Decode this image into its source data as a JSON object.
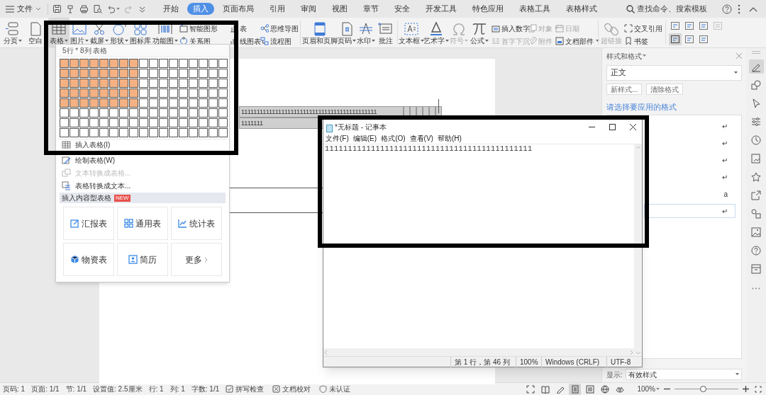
{
  "title_bar": {
    "file_menu": "文件",
    "tabs": [
      {
        "label": "开始",
        "selected": false
      },
      {
        "label": "插入",
        "selected": true
      },
      {
        "label": "页面布局",
        "selected": false
      },
      {
        "label": "引用",
        "selected": false
      },
      {
        "label": "审阅",
        "selected": false
      },
      {
        "label": "视图",
        "selected": false
      },
      {
        "label": "章节",
        "selected": false
      },
      {
        "label": "安全",
        "selected": false
      },
      {
        "label": "开发工具",
        "selected": false
      },
      {
        "label": "特色应用",
        "selected": false
      },
      {
        "label": "表格工具",
        "selected": false
      },
      {
        "label": "表格样式",
        "selected": false
      }
    ],
    "search_placeholder": "查找命令、搜索模板"
  },
  "ribbon": {
    "groups": [
      {
        "items": [
          {
            "kind": "large",
            "label": "分页",
            "dropdown": true,
            "selected": false,
            "disabled": false
          },
          {
            "kind": "large",
            "label": "空白",
            "dropdown": false,
            "selected": false,
            "disabled": false
          },
          {
            "kind": "large",
            "label": "表格",
            "dropdown": true,
            "selected": true,
            "disabled": false
          },
          {
            "kind": "large",
            "label": "图片",
            "dropdown": true,
            "selected": false,
            "disabled": false
          },
          {
            "kind": "large",
            "label": "截屏",
            "dropdown": true,
            "selected": false,
            "disabled": false
          },
          {
            "kind": "large",
            "label": "形状",
            "dropdown": true,
            "selected": false,
            "disabled": false
          },
          {
            "kind": "large",
            "label": "图标库",
            "dropdown": false,
            "selected": false,
            "disabled": false
          },
          {
            "kind": "large",
            "label": "功能图",
            "dropdown": true,
            "selected": false,
            "disabled": false
          },
          {
            "kind": "stack",
            "rows": [
              {
                "label": "智能图形",
                "dropdown": false,
                "disabled": false
              },
              {
                "label": "关系图",
                "dropdown": false,
                "disabled": false
              }
            ]
          },
          {
            "kind": "stack",
            "rows": [
              {
                "label": "表",
                "dropdown": false,
                "disabled": false
              },
              {
                "label": "线图表",
                "dropdown": false,
                "disabled": false
              }
            ]
          },
          {
            "kind": "stack",
            "rows": [
              {
                "label": "思维导图",
                "dropdown": false,
                "disabled": false
              },
              {
                "label": "流程图",
                "dropdown": false,
                "disabled": false
              }
            ]
          }
        ]
      },
      {
        "items": [
          {
            "kind": "large",
            "label": "页眉和页脚",
            "dropdown": false,
            "selected": false,
            "disabled": false
          },
          {
            "kind": "large",
            "label": "页码",
            "dropdown": true,
            "selected": false,
            "disabled": false
          },
          {
            "kind": "large",
            "label": "水印",
            "dropdown": true,
            "selected": false,
            "disabled": false
          },
          {
            "kind": "large",
            "label": "批注",
            "dropdown": false,
            "selected": false,
            "disabled": false
          }
        ]
      },
      {
        "items": [
          {
            "kind": "large",
            "label": "文本框",
            "dropdown": true,
            "selected": false,
            "disabled": false
          },
          {
            "kind": "large",
            "label": "艺术字",
            "dropdown": true,
            "selected": false,
            "disabled": false
          },
          {
            "kind": "large",
            "label": "符号",
            "dropdown": true,
            "selected": false,
            "disabled": true
          },
          {
            "kind": "large",
            "label": "公式",
            "dropdown": true,
            "selected": false,
            "disabled": false
          },
          {
            "kind": "stack",
            "rows": [
              {
                "label": "插入数字",
                "dropdown": false,
                "disabled": false
              },
              {
                "label": "首字下沉",
                "dropdown": false,
                "disabled": true
              }
            ]
          },
          {
            "kind": "stack",
            "rows": [
              {
                "label": "对象",
                "dropdown": true,
                "disabled": true
              },
              {
                "label": "附件",
                "dropdown": false,
                "disabled": true
              }
            ]
          },
          {
            "kind": "stack",
            "rows": [
              {
                "label": "日期",
                "dropdown": false,
                "disabled": true
              },
              {
                "label": "文档部件",
                "dropdown": true,
                "disabled": false
              }
            ]
          }
        ]
      },
      {
        "items": [
          {
            "kind": "large",
            "label": "超链接",
            "dropdown": false,
            "selected": false,
            "disabled": true
          },
          {
            "kind": "stack",
            "rows": [
              {
                "label": "交叉引用",
                "dropdown": false,
                "disabled": false
              },
              {
                "label": "书签",
                "dropdown": false,
                "disabled": false
              }
            ]
          }
        ]
      },
      {
        "items": [
          {
            "kind": "icon_grid",
            "buttons": [
              {
                "selected": false,
                "disabled": false
              },
              {
                "selected": false,
                "disabled": false
              },
              {
                "selected": false,
                "disabled": false
              },
              {
                "selected": false,
                "disabled": true
              },
              {
                "selected": true,
                "disabled": false
              },
              {
                "selected": false,
                "disabled": false
              },
              {
                "selected": false,
                "disabled": false
              }
            ]
          }
        ]
      }
    ]
  },
  "document": {
    "table_rows": [
      "11111111111111111111111111111111111111111111",
      "1111111"
    ]
  },
  "table_menu": {
    "size_label": "5行 * 8列 表格",
    "grid": [
      [
        true,
        true,
        true,
        true,
        true,
        true,
        true,
        true,
        false,
        false,
        false,
        false,
        false,
        false,
        false,
        false,
        false
      ],
      [
        true,
        true,
        true,
        true,
        true,
        true,
        true,
        true,
        false,
        false,
        false,
        false,
        false,
        false,
        false,
        false,
        false
      ],
      [
        true,
        true,
        true,
        true,
        true,
        true,
        true,
        true,
        false,
        false,
        false,
        false,
        false,
        false,
        false,
        false,
        false
      ],
      [
        true,
        true,
        true,
        true,
        true,
        true,
        true,
        true,
        false,
        false,
        false,
        false,
        false,
        false,
        false,
        false,
        false
      ],
      [
        true,
        true,
        true,
        true,
        true,
        true,
        true,
        true,
        false,
        false,
        false,
        false,
        false,
        false,
        false,
        false,
        false
      ],
      [
        false,
        false,
        false,
        false,
        false,
        false,
        false,
        false,
        false,
        false,
        false,
        false,
        false,
        false,
        false,
        false,
        false
      ],
      [
        false,
        false,
        false,
        false,
        false,
        false,
        false,
        false,
        false,
        false,
        false,
        false,
        false,
        false,
        false,
        false,
        false
      ],
      [
        false,
        false,
        false,
        false,
        false,
        false,
        false,
        false,
        false,
        false,
        false,
        false,
        false,
        false,
        false,
        false,
        false
      ]
    ],
    "items": [
      {
        "label": "插入表格(I)",
        "disabled": false
      },
      {
        "label": "绘制表格(W)",
        "disabled": false
      },
      {
        "label": "文本转换成表格...",
        "disabled": true
      },
      {
        "label": "表格转换成文本...",
        "disabled": false
      }
    ],
    "section_title": "插入内容型表格",
    "new_badge": "NEW",
    "templates": [
      {
        "kind": "template",
        "label": "汇报表"
      },
      {
        "kind": "template",
        "label": "通用表"
      },
      {
        "kind": "template",
        "label": "统计表"
      },
      {
        "kind": "template",
        "label": "物资表"
      },
      {
        "kind": "template",
        "label": "简历"
      },
      {
        "kind": "more",
        "label": "更多"
      }
    ]
  },
  "notepad": {
    "title": "*无标题 - 记事本",
    "menus": [
      "文件(F)",
      "编辑(E)",
      "格式(O)",
      "查看(V)",
      "帮助(H)"
    ],
    "text": "111111111111111111111111111111111111111111111",
    "status": [
      "第 1 行，第 46 列",
      "100%",
      "Windows (CRLF)",
      "UTF-8"
    ]
  },
  "styles_panel": {
    "title": "样式和格式",
    "current_style": "正文",
    "buttons": [
      "新样式...",
      "清除格式"
    ],
    "prompt": "请选择要应用的格式",
    "entries": [
      {
        "mark": "↵",
        "selected": false
      },
      {
        "mark": "↵",
        "selected": false
      },
      {
        "mark": "↵",
        "selected": false
      },
      {
        "mark": "↵",
        "selected": false
      },
      {
        "mark": "a",
        "selected": false
      },
      {
        "mark": "↵",
        "selected": true
      }
    ],
    "show_label": "显示:",
    "show_value": "有效样式"
  },
  "side_toolbar": [
    {
      "selected": true
    },
    {
      "selected": false
    },
    {
      "selected": false
    },
    {
      "selected": false
    },
    {
      "selected": false
    },
    {
      "selected": false
    },
    {
      "selected": false
    },
    {
      "selected": false
    },
    {
      "selected": false
    },
    {
      "selected": false
    },
    {
      "selected": false
    },
    {
      "selected": false
    }
  ],
  "status_bar": {
    "items": [
      {
        "kind": "text",
        "label": "页码: 1"
      },
      {
        "kind": "text",
        "label": "页面: 1/1"
      },
      {
        "kind": "text",
        "label": "节: 1/1"
      },
      {
        "kind": "text",
        "label": "设置值: 2.5厘米"
      },
      {
        "kind": "text",
        "label": "行: 1"
      },
      {
        "kind": "text",
        "label": "列: 1"
      },
      {
        "kind": "text",
        "label": "字数: 1/1"
      },
      {
        "kind": "icon",
        "label": "拼写检查"
      },
      {
        "kind": "icon",
        "label": "文档校对"
      },
      {
        "kind": "icon",
        "label": "未认证"
      }
    ],
    "views": [
      {
        "selected": false
      },
      {
        "selected": false
      },
      {
        "selected": false
      },
      {
        "selected": true
      },
      {
        "selected": false
      },
      {
        "selected": false
      },
      {
        "selected": false
      }
    ],
    "zoom": "100%",
    "zoom_slider": {
      "level": 0.45
    }
  },
  "annotation_frames": [
    {
      "kind": "frame"
    },
    {
      "kind": "frame"
    }
  ]
}
